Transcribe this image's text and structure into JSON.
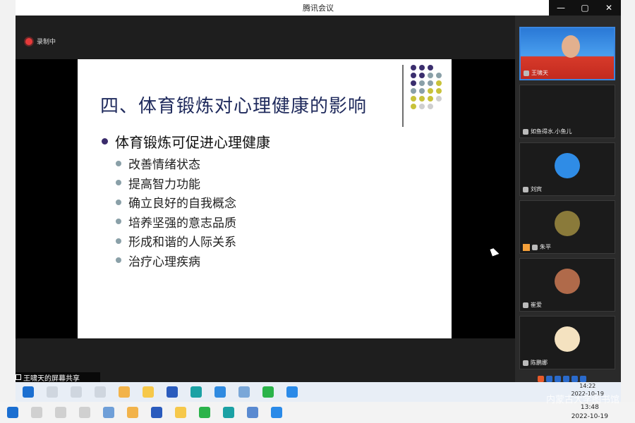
{
  "window": {
    "title": "腾讯会议",
    "controls": [
      "—",
      "▢",
      "✕"
    ]
  },
  "recording": {
    "label": "录制中"
  },
  "slide": {
    "title": "四、体育锻炼对心理健康的影响",
    "main_bullet": "体育锻炼可促进心理健康",
    "sub_bullets": [
      "改善情绪状态",
      "提高智力功能",
      "确立良好的自我概念",
      "培养坚强的意志品质",
      "形成和谐的人际关系",
      "治疗心理疾病"
    ],
    "dot_colors": [
      "#3b2e6e",
      "#3b2e6e",
      "#3b2e6e",
      "",
      "#3b2e6e",
      "#3b2e6e",
      "#8aa0a8",
      "#8aa0a8",
      "#3b2e6e",
      "#8aa0a8",
      "#8aa0a8",
      "#c8c23a",
      "#8aa0a8",
      "#8aa0a8",
      "#c8c23a",
      "#c8c23a",
      "#c8c23a",
      "#c8c23a",
      "#c8c23a",
      "#cfcfcf",
      "#c8c23a",
      "#cfcfcf",
      "#cfcfcf",
      ""
    ]
  },
  "share_label": "王啸天的屏幕共享",
  "participants": [
    {
      "name": "王啸天"
    },
    {
      "name": "如鱼得水.小鱼儿"
    },
    {
      "name": "刘宾"
    },
    {
      "name": "朱平"
    },
    {
      "name": "崔爱"
    },
    {
      "name": "陈鹏娜"
    }
  ],
  "taskbar_inner": {
    "time": "14:22",
    "date": "2022-10-19"
  },
  "taskbar_outer": {
    "time": "13:48",
    "date": "2022-10-19"
  },
  "watermark": "内蒙古大学图书馆"
}
